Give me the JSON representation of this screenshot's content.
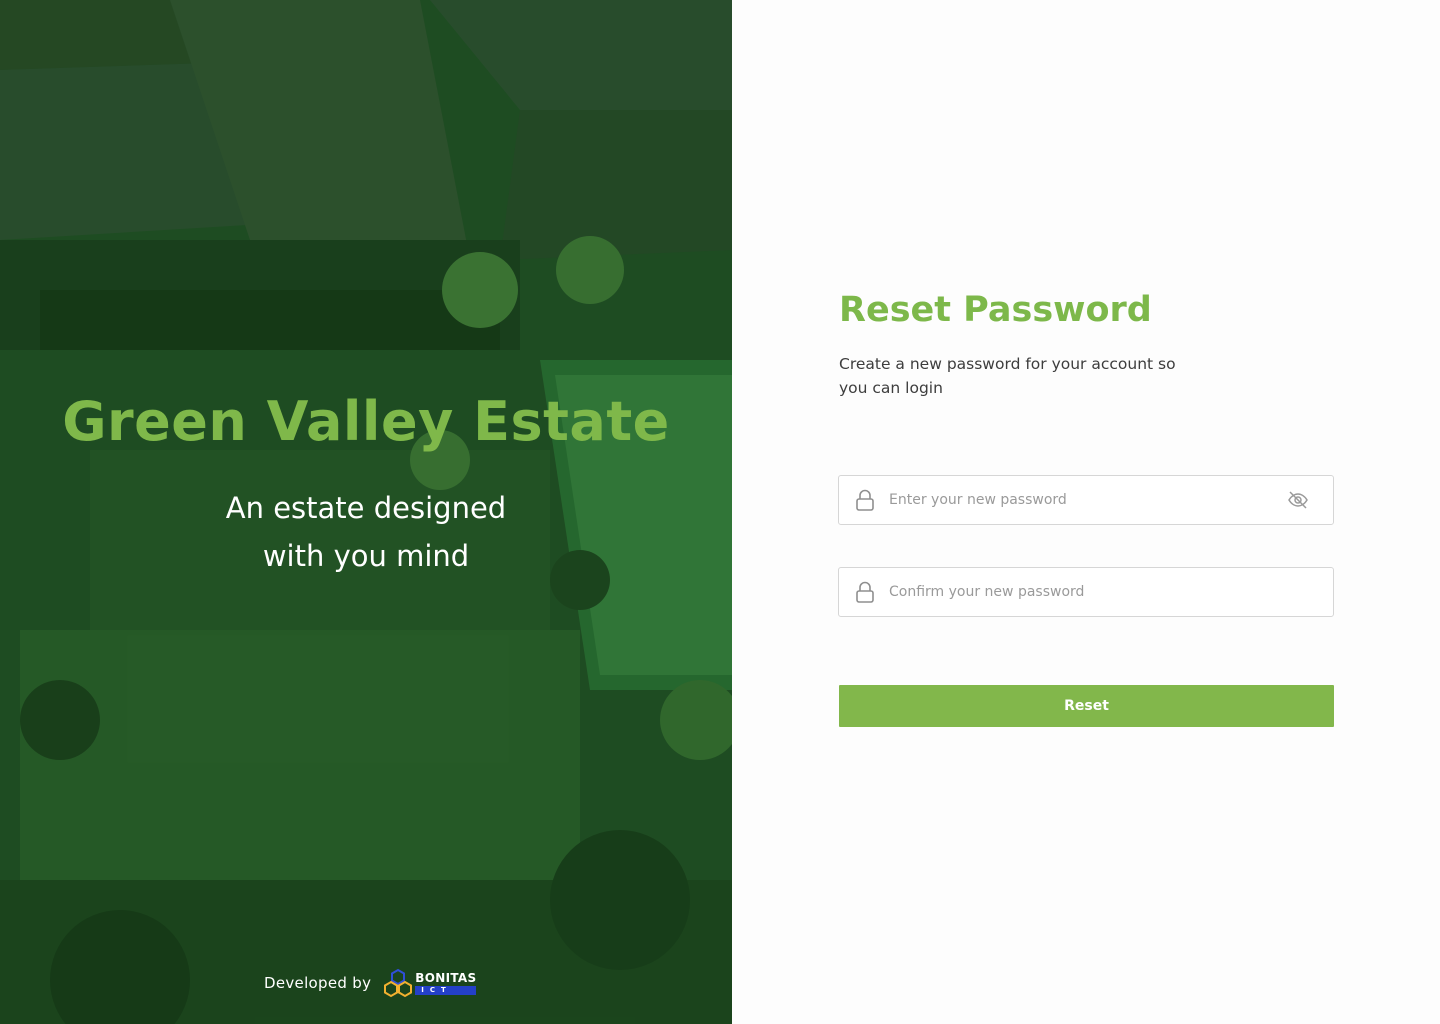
{
  "hero": {
    "title": "Green Valley Estate",
    "tagline_line1": "An estate designed",
    "tagline_line2": "with you mind",
    "credits_label": "Developed by",
    "brand_name": "BONITAS",
    "brand_sub": "ICT"
  },
  "form": {
    "title": "Reset Password",
    "subtitle": "Create a new password for your account so you can login",
    "new_password_placeholder": "Enter your new password",
    "confirm_password_placeholder": "Confirm your new password",
    "submit_label": "Reset"
  },
  "icons": {
    "lock": "lock-icon",
    "eye": "eye-off-icon",
    "brand": "hexagon-logo-icon"
  },
  "colors": {
    "accent": "#82b74b",
    "hero_overlay": "#1f4a1f",
    "brand_blue": "#2440c8"
  }
}
